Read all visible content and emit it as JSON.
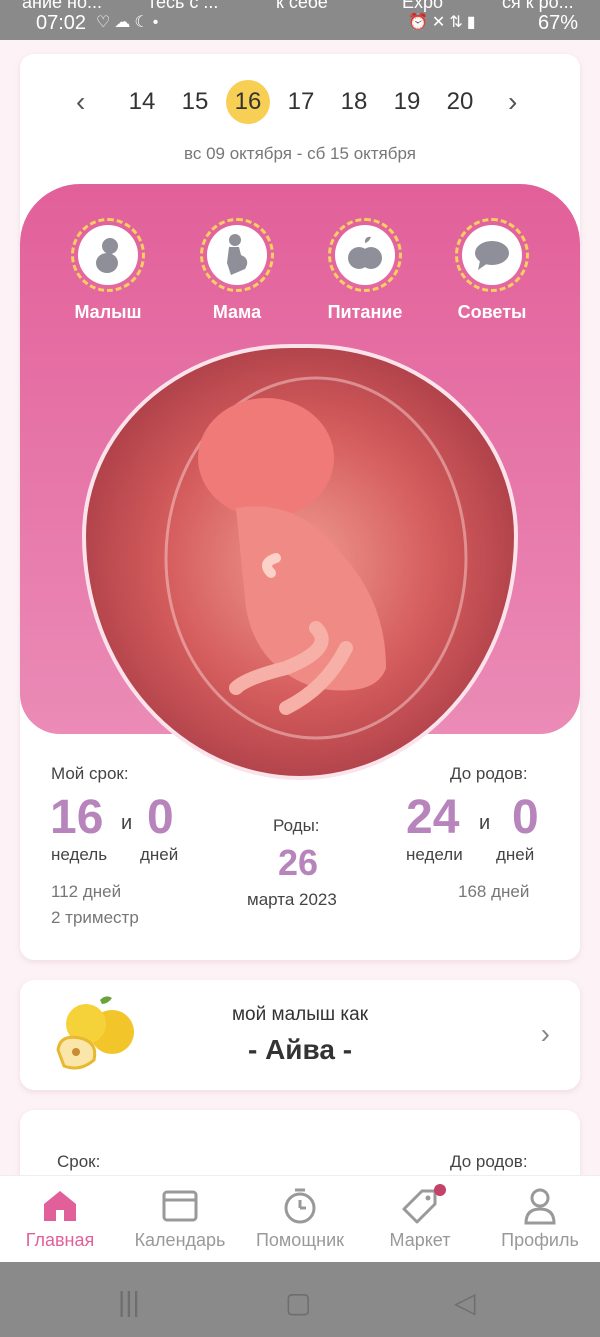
{
  "status": {
    "notif_1": "ание но...",
    "notif_2": "тесь с ...",
    "notif_3": "к себе",
    "notif_4": "Expo",
    "notif_5": "ся к ро...",
    "time": "07:02",
    "battery": "67%"
  },
  "week_nav": {
    "weeks": [
      "14",
      "15",
      "16",
      "17",
      "18",
      "19",
      "20"
    ],
    "active_week": "16",
    "range": "вс 09 октября - сб 15 октября"
  },
  "categories": [
    {
      "label": "Малыш",
      "icon": "baby-icon"
    },
    {
      "label": "Мама",
      "icon": "pregnant-woman-icon"
    },
    {
      "label": "Питание",
      "icon": "apple-icon"
    },
    {
      "label": "Советы",
      "icon": "speech-bubble-icon"
    }
  ],
  "stats": {
    "my_term_label": "Мой срок:",
    "weeks_value": "16",
    "and": "и",
    "days_value": "0",
    "weeks_unit": "недель",
    "days_unit": "дней",
    "total_days": "112 дней",
    "trimester": "2 триместр",
    "birth_label": "Роды:",
    "birth_day": "26",
    "birth_month_year": "марта 2023",
    "until_birth_label": "До родов:",
    "remaining_weeks": "24",
    "remaining_days": "0",
    "remaining_weeks_unit": "недели",
    "remaining_days_unit": "дней",
    "remaining_total_days": "168 дней"
  },
  "fruit": {
    "title": "мой малыш как",
    "name": "- Айва -"
  },
  "partial": {
    "term_label": "Срок:",
    "until_label": "До родов:"
  },
  "nav": [
    {
      "label": "Главная",
      "icon": "home-icon",
      "active": true
    },
    {
      "label": "Календарь",
      "icon": "calendar-icon",
      "active": false
    },
    {
      "label": "Помощник",
      "icon": "timer-icon",
      "active": false
    },
    {
      "label": "Маркет",
      "icon": "tag-icon",
      "active": false
    },
    {
      "label": "Профиль",
      "icon": "profile-icon",
      "active": false
    }
  ],
  "colors": {
    "accent_pink": "#e2609a",
    "number_purple": "#b784bc",
    "active_week": "#f7cf55"
  }
}
